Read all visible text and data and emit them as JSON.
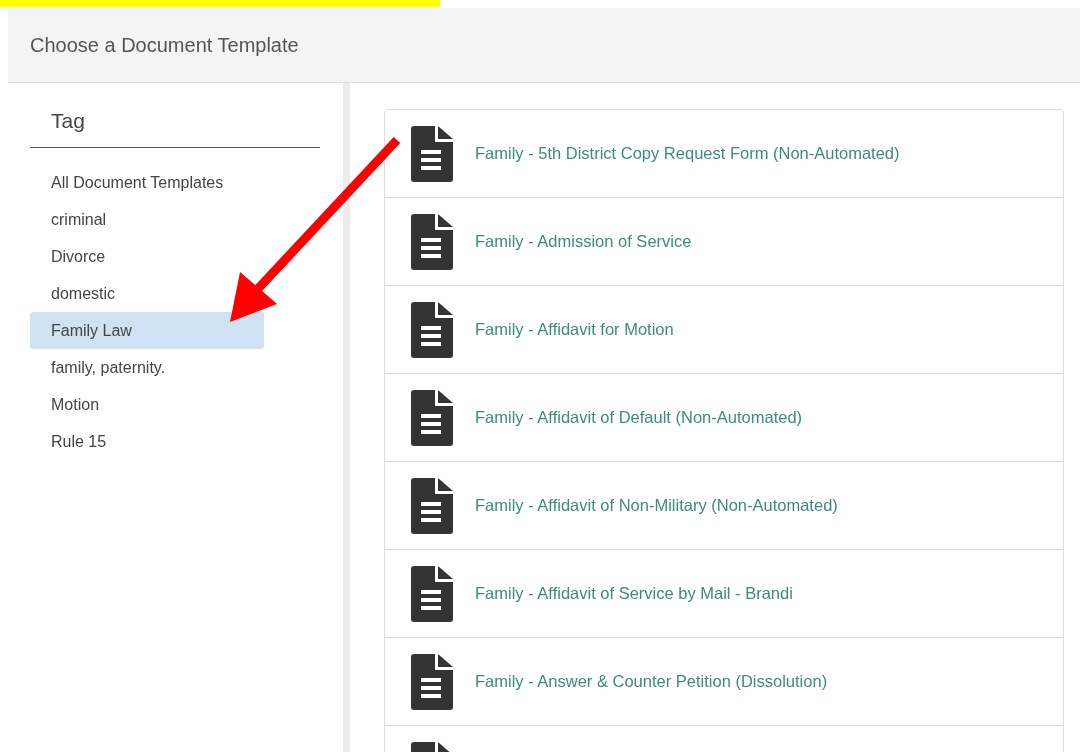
{
  "header": {
    "title": "Choose a Document Template"
  },
  "sidebar": {
    "heading": "Tag",
    "items": [
      {
        "label": "All Document Templates",
        "selected": false
      },
      {
        "label": "criminal",
        "selected": false
      },
      {
        "label": "Divorce",
        "selected": false
      },
      {
        "label": "domestic",
        "selected": false
      },
      {
        "label": "Family Law",
        "selected": true
      },
      {
        "label": "family, paternity.",
        "selected": false
      },
      {
        "label": "Motion",
        "selected": false
      },
      {
        "label": "Rule 15",
        "selected": false
      }
    ]
  },
  "templates": [
    {
      "title": "Family - 5th District Copy Request Form (Non-Automated)"
    },
    {
      "title": "Family - Admission of Service"
    },
    {
      "title": "Family - Affidavit for Motion"
    },
    {
      "title": "Family - Affidavit of Default (Non-Automated)"
    },
    {
      "title": "Family - Affidavit of Non-Military (Non-Automated)"
    },
    {
      "title": "Family - Affidavit of Service by Mail - Brandi"
    },
    {
      "title": "Family - Answer & Counter Petition (Dissolution)"
    }
  ],
  "more_rows_below": true,
  "annotation": {
    "kind": "arrow",
    "color": "#ff0000"
  }
}
